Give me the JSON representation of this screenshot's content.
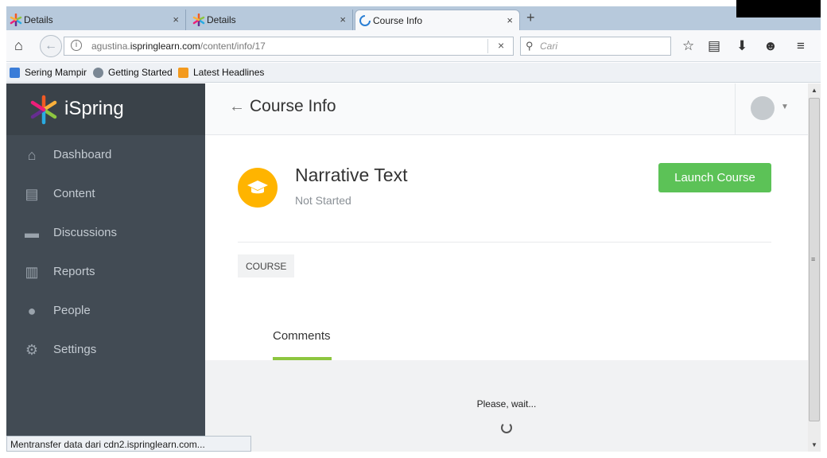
{
  "browser": {
    "tabs": [
      {
        "label": "Details",
        "close": "×"
      },
      {
        "label": "Details",
        "close": "×"
      },
      {
        "label": "Course Info",
        "close": "×"
      }
    ],
    "new_tab": "+",
    "url_prefix": "agustina.",
    "url_domain": "ispringlearn.com",
    "url_path": "/content/info/17",
    "url_clear": "×",
    "search_placeholder": "Cari",
    "bookmarks": [
      "Sering Mampir",
      "Getting Started",
      "Latest Headlines"
    ],
    "status": "Mentransfer data dari cdn2.ispringlearn.com..."
  },
  "sidebar": {
    "brand": "iSpring",
    "items": [
      {
        "label": "Dashboard",
        "icon": "home-icon"
      },
      {
        "label": "Content",
        "icon": "clipboard-icon"
      },
      {
        "label": "Discussions",
        "icon": "chat-icon"
      },
      {
        "label": "Reports",
        "icon": "bar-chart-icon"
      },
      {
        "label": "People",
        "icon": "person-icon"
      },
      {
        "label": "Settings",
        "icon": "gear-icon"
      }
    ]
  },
  "header": {
    "back": "←",
    "title": "Course Info"
  },
  "course": {
    "title": "Narrative Text",
    "status": "Not Started",
    "launch_label": "Launch Course",
    "tag": "COURSE"
  },
  "comments": {
    "tab_label": "Comments",
    "wait_text": "Please, wait..."
  },
  "colors": {
    "sidebar": "#424b54",
    "accent_green": "#5cc257",
    "course_icon": "#ffb400",
    "tab_underline": "#8dc63f"
  }
}
